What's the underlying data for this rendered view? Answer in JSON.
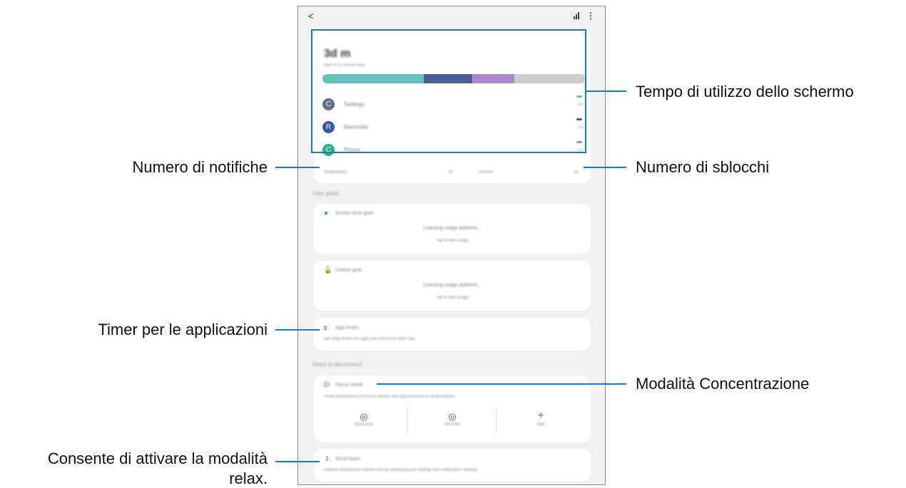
{
  "phone": {
    "back_glyph": "<",
    "more_glyph": "⋮",
    "screen_time": {
      "value": "3d m",
      "subtitle": "Mon 4:15 screen time",
      "segments": [
        {
          "color": "#62c4b6",
          "fraction": 0.385
        },
        {
          "color": "#475e96",
          "fraction": 0.185
        },
        {
          "color": "#a88bcb",
          "fraction": 0.16
        },
        {
          "color": "#cdcdcd",
          "fraction": 0.27
        }
      ],
      "apps": [
        {
          "name": "Settings",
          "time": "1m",
          "icon": "C",
          "icon_color": "#60708a",
          "pill_color": "#62c4b6"
        },
        {
          "name": "Reminder",
          "time": "1m",
          "icon": "R",
          "icon_color": "#3c55a8",
          "pill_color": "#475e96"
        },
        {
          "name": "Phone",
          "time": "1m",
          "icon": "C",
          "icon_color": "#2bb380",
          "pill_color": "#a88bcb"
        }
      ]
    },
    "stats": {
      "notifications_label": "Notifications",
      "notifications_value": "30",
      "unlocks_label": "Unlocks",
      "unlocks_value": "38"
    },
    "your_goals_label": "Your goals",
    "screen_time_goal": {
      "title": "Screen time goal",
      "status": "Learning usage patterns...",
      "sub": "Tap to edit usage"
    },
    "unlock_goal": {
      "title": "Unlock goal",
      "status": "Learning usage patterns...",
      "sub": "Tap to edit usage"
    },
    "app_timers": {
      "title": "App timers",
      "desc": "Set daily timers for apps you use most each day"
    },
    "ways_label": "Ways to disconnect",
    "focus_mode": {
      "title": "Focus mode",
      "desc": "Avoid distractions from your phone and stay focused on what matters",
      "modes": [
        {
          "label": "Work time",
          "glyph": "◎"
        },
        {
          "label": "Me time",
          "glyph": "◎"
        },
        {
          "label": "Add",
          "glyph": "+"
        }
      ]
    },
    "wind_down": {
      "title": "Wind Down",
      "desc": "Reduce distractions before bed by changing your display and notification settings"
    }
  },
  "callouts": {
    "screen_time": "Tempo di utilizzo dello schermo",
    "notifications": "Numero di notifiche",
    "unlocks": "Numero di sblocchi",
    "app_timers": "Timer per le applicazioni",
    "focus_mode": "Modalità Concentrazione",
    "relax_line1": "Consente di attivare la modalità",
    "relax_line2": "relax."
  }
}
